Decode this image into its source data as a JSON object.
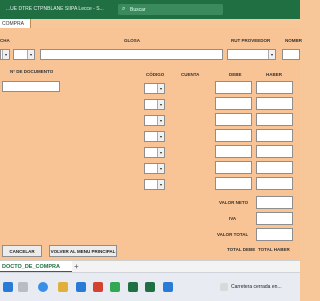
{
  "titlebar": {
    "title": "...UE DTRE CTPNBLANE SIIPA Lecce - S...",
    "search_placeholder": "Buscar"
  },
  "sheet_header": "COMPRA",
  "labels": {
    "fecha": "CHA",
    "glosa": "GLOSA",
    "rut_proveedor": "RUT PROVEEDOR",
    "nombre": "NOMBR",
    "n_documento": "N° DE DOCUMENTO",
    "codigo": "CÓDIGO",
    "cuenta": "CUENTA",
    "debe": "DEBE",
    "haber": "HABER",
    "valor_neto": "VALOR NETO",
    "iva": "IVA",
    "valor_total": "VALOR TOTAL",
    "total_debe": "TOTAL DEBE",
    "total_haber": "TOTAL HABER"
  },
  "buttons": {
    "cancelar": "CANCELAR",
    "volver": "VOLVER AL MENU PRINCIPAL"
  },
  "sheet_tabs": [
    {
      "label": "DOCTO_DE_COMPRA"
    }
  ],
  "notification": {
    "text": "Carretera cerrada en..."
  },
  "rows": 7
}
